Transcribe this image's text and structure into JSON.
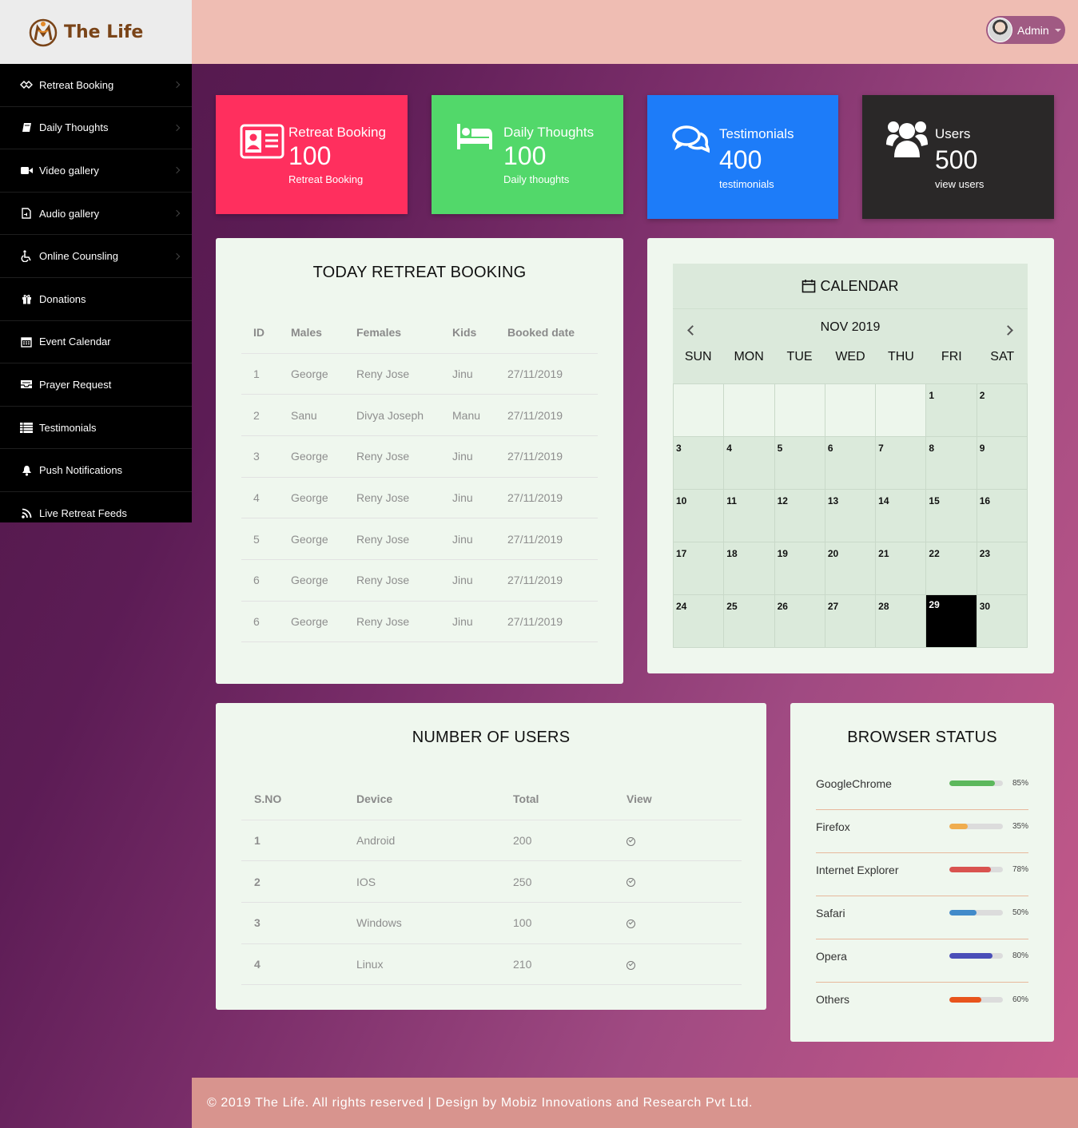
{
  "brand": {
    "name": "The Life"
  },
  "user": {
    "name": "Admin"
  },
  "sidebar": {
    "items": [
      {
        "label": "Retreat Booking",
        "icon": "handshake-icon"
      },
      {
        "label": "Daily Thoughts",
        "icon": "book-icon"
      },
      {
        "label": "Video gallery",
        "icon": "video-camera-icon"
      },
      {
        "label": "Audio gallery",
        "icon": "audio-file-icon"
      },
      {
        "label": "Online Counsling",
        "icon": "wheelchair-icon"
      },
      {
        "label": "Donations",
        "icon": "gift-icon"
      },
      {
        "label": "Event Calendar",
        "icon": "calendar-icon"
      },
      {
        "label": "Prayer Request",
        "icon": "inbox-icon"
      },
      {
        "label": "Testimonials",
        "icon": "list-icon"
      },
      {
        "label": "Push Notifications",
        "icon": "bell-icon"
      },
      {
        "label": "Live Retreat Feeds",
        "icon": "rss-icon"
      }
    ]
  },
  "stats": [
    {
      "title": "Retreat Booking",
      "value": "100",
      "sub": "Retreat Booking",
      "color": "#ff2f5e",
      "icon": "id-card-icon"
    },
    {
      "title": "Daily Thoughts",
      "value": "100",
      "sub": "Daily thoughts",
      "color": "#52d86a",
      "icon": "bed-icon"
    },
    {
      "title": "Testimonials",
      "value": "400",
      "sub": "testimonials",
      "color": "#1d7cf9",
      "icon": "comments-icon"
    },
    {
      "title": "Users",
      "value": "500",
      "sub": "view users",
      "color": "#2a2828",
      "icon": "users-icon"
    }
  ],
  "booking": {
    "title": "TODAY RETREAT BOOKING",
    "headers": [
      "ID",
      "Males",
      "Females",
      "Kids",
      "Booked date"
    ],
    "rows": [
      [
        "1",
        "George",
        "Reny Jose",
        "Jinu",
        "27/11/2019"
      ],
      [
        "2",
        "Sanu",
        "Divya Joseph",
        "Manu",
        "27/11/2019"
      ],
      [
        "3",
        "George",
        "Reny Jose",
        "Jinu",
        "27/11/2019"
      ],
      [
        "4",
        "George",
        "Reny Jose",
        "Jinu",
        "27/11/2019"
      ],
      [
        "5",
        "George",
        "Reny Jose",
        "Jinu",
        "27/11/2019"
      ],
      [
        "6",
        "George",
        "Reny Jose",
        "Jinu",
        "27/11/2019"
      ],
      [
        "6",
        "George",
        "Reny Jose",
        "Jinu",
        "27/11/2019"
      ]
    ]
  },
  "calendar": {
    "title": "CALENDAR",
    "month": "NOV 2019",
    "days": [
      "SUN",
      "MON",
      "TUE",
      "WED",
      "THU",
      "FRI",
      "SAT"
    ],
    "blanks": 5,
    "days_in_month": 30,
    "today": 29
  },
  "users": {
    "title": "NUMBER OF USERS",
    "headers": [
      "S.NO",
      "Device",
      "Total",
      "View"
    ],
    "rows": [
      [
        "1",
        "Android",
        "200"
      ],
      [
        "2",
        "IOS",
        "250"
      ],
      [
        "3",
        "Windows",
        "100"
      ],
      [
        "4",
        "Linux",
        "210"
      ]
    ]
  },
  "browser": {
    "title": "BROWSER STATUS",
    "rows": [
      {
        "name": "GoogleChrome",
        "pct": "85%",
        "value": 85,
        "color": "#5cb85c"
      },
      {
        "name": "Firefox",
        "pct": "35%",
        "value": 35,
        "color": "#f0ad4e"
      },
      {
        "name": "Internet Explorer",
        "pct": "78%",
        "value": 78,
        "color": "#d9534f"
      },
      {
        "name": "Safari",
        "pct": "50%",
        "value": 50,
        "color": "#428bca"
      },
      {
        "name": "Opera",
        "pct": "80%",
        "value": 80,
        "color": "#4a4fb8"
      },
      {
        "name": "Others",
        "pct": "60%",
        "value": 60,
        "color": "#e8541c"
      }
    ]
  },
  "footer": {
    "text": "© 2019 The Life. All rights reserved | Design by Mobiz Innovations and Research Pvt Ltd."
  }
}
